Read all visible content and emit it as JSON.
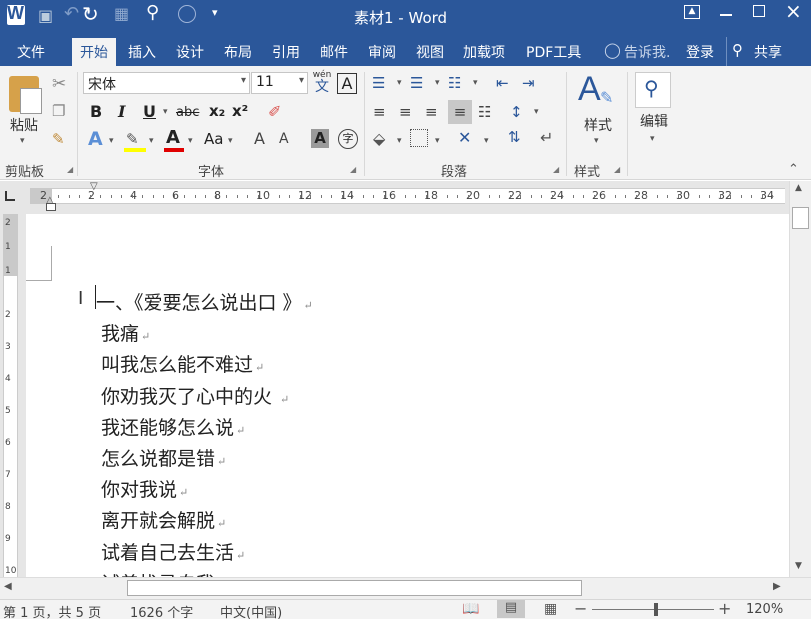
{
  "title": {
    "window_title": "素材1 - Word",
    "qat_more": "▾"
  },
  "tabs": [
    {
      "label": "文件"
    },
    {
      "label": "开始"
    },
    {
      "label": "插入"
    },
    {
      "label": "设计"
    },
    {
      "label": "布局"
    },
    {
      "label": "引用"
    },
    {
      "label": "邮件"
    },
    {
      "label": "审阅"
    },
    {
      "label": "视图"
    },
    {
      "label": "加载项"
    },
    {
      "label": "PDF工具"
    }
  ],
  "tell_me": "告诉我.",
  "signin": "登录",
  "share": "共享",
  "ribbon": {
    "paste_label": "粘贴",
    "clipboard_group": "剪贴板",
    "font_name": "宋体",
    "font_size": "11",
    "font_group": "字体",
    "paragraph_group": "段落",
    "styles_label": "样式",
    "styles_group": "样式",
    "editing_label": "编辑",
    "wen_glyph": "wén",
    "wen_char": "文",
    "a_char": "A",
    "bold": "B",
    "italic": "I",
    "underline": "U",
    "strike": "abc",
    "sub": "x₂",
    "sup": "x²",
    "aa": "Aa",
    "a_up": "A",
    "a_down": "A",
    "char_shade": "A",
    "enclose": "字"
  },
  "ruler": {
    "h_ticks": [
      "2",
      "2",
      "4",
      "6",
      "8",
      "10",
      "12",
      "14",
      "16",
      "18",
      "20",
      "22",
      "24",
      "26",
      "28",
      "30",
      "32",
      "34"
    ],
    "v_ticks": [
      "2",
      "1",
      "1",
      "2",
      "3",
      "4",
      "5",
      "6",
      "7",
      "8",
      "9",
      "10"
    ]
  },
  "document": {
    "lines": [
      "一、《爱要怎么说出口 》",
      "我痛",
      "叫我怎么能不难过",
      "你劝我灭了心中的火 ",
      "我还能够怎么说",
      "怎么说都是错",
      "你对我说",
      "离开就会解脱",
      "试着自己去生活",
      "试着找寻自我"
    ],
    "para_mark": "↵"
  },
  "status": {
    "page": "第 1 页，共 5 页",
    "words": "1626 个字",
    "language": "中文(中国)",
    "zoom": "120%"
  },
  "colors": {
    "accent": "#2b579a",
    "highlight": "#ffff00",
    "font_color": "#e00000"
  }
}
